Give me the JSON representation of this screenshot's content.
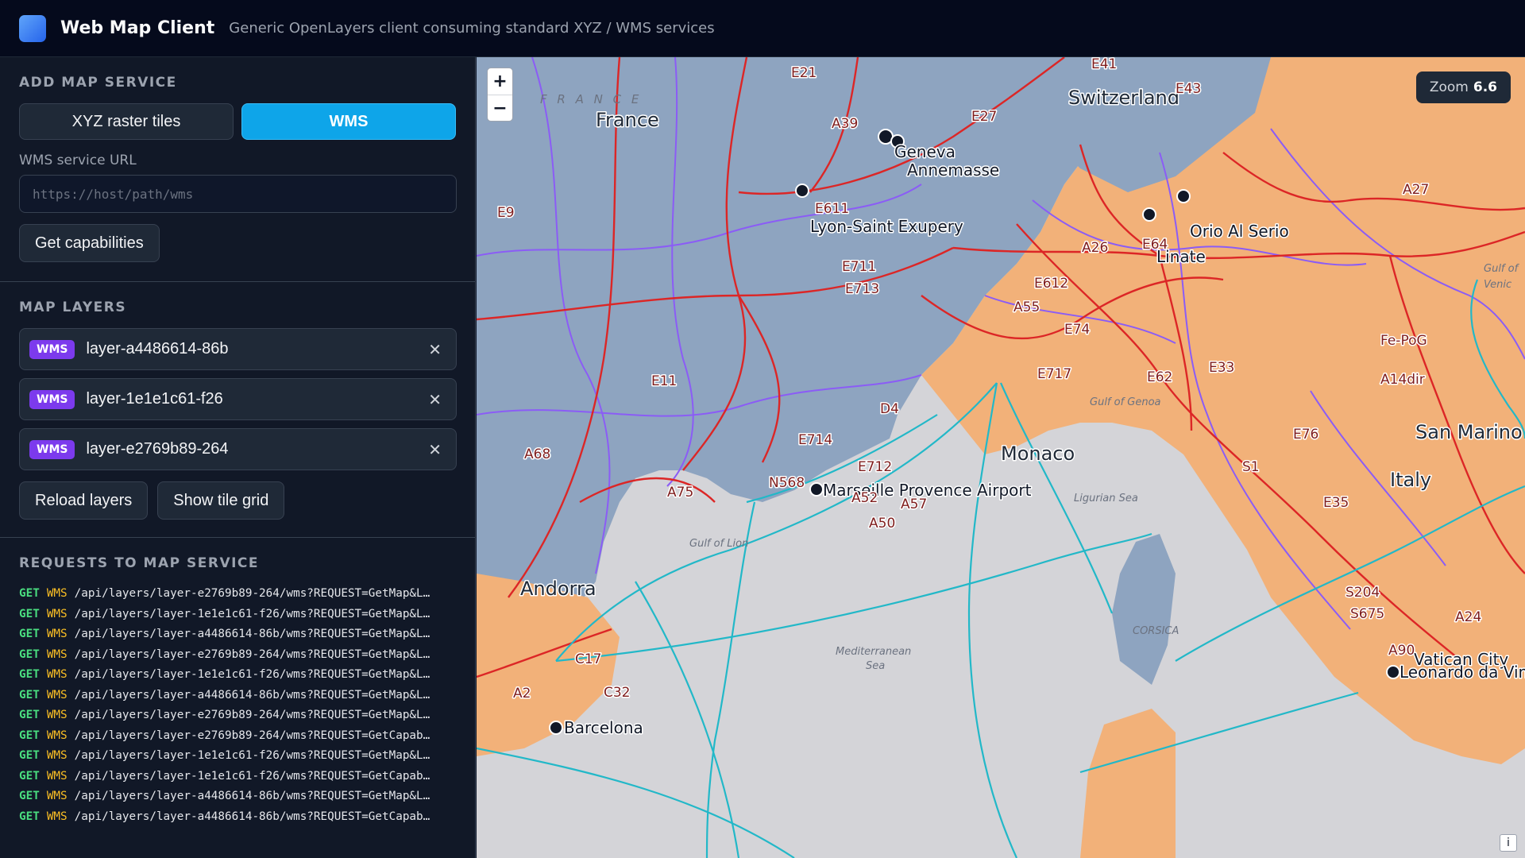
{
  "app": {
    "title": "Web Map Client",
    "subtitle": "Generic OpenLayers client consuming standard XYZ / WMS services"
  },
  "add_service": {
    "heading": "ADD MAP SERVICE",
    "tab_xyz": "XYZ raster tiles",
    "tab_wms": "WMS",
    "active_tab": "WMS",
    "url_label": "WMS service URL",
    "url_value": "",
    "url_placeholder": "https://host/path/wms",
    "capabilities_button": "Get capabilities"
  },
  "layers": {
    "heading": "MAP LAYERS",
    "items": [
      {
        "type": "WMS",
        "name": "layer-a4486614-86b",
        "remove": "✕"
      },
      {
        "type": "WMS",
        "name": "layer-1e1e1c61-f26",
        "remove": "✕"
      },
      {
        "type": "WMS",
        "name": "layer-e2769b89-264",
        "remove": "✕"
      }
    ],
    "reload_button": "Reload layers",
    "tilegrid_button": "Show tile grid"
  },
  "requests": {
    "heading": "REQUESTS TO MAP SERVICE",
    "rows": [
      {
        "method": "GET",
        "service": "WMS",
        "path": "/api/layers/layer-e2769b89-264/wms?REQUEST=GetMap&L…"
      },
      {
        "method": "GET",
        "service": "WMS",
        "path": "/api/layers/layer-1e1e1c61-f26/wms?REQUEST=GetMap&L…"
      },
      {
        "method": "GET",
        "service": "WMS",
        "path": "/api/layers/layer-a4486614-86b/wms?REQUEST=GetMap&L…"
      },
      {
        "method": "GET",
        "service": "WMS",
        "path": "/api/layers/layer-e2769b89-264/wms?REQUEST=GetMap&L…"
      },
      {
        "method": "GET",
        "service": "WMS",
        "path": "/api/layers/layer-1e1e1c61-f26/wms?REQUEST=GetMap&L…"
      },
      {
        "method": "GET",
        "service": "WMS",
        "path": "/api/layers/layer-a4486614-86b/wms?REQUEST=GetMap&L…"
      },
      {
        "method": "GET",
        "service": "WMS",
        "path": "/api/layers/layer-e2769b89-264/wms?REQUEST=GetMap&L…"
      },
      {
        "method": "GET",
        "service": "WMS",
        "path": "/api/layers/layer-e2769b89-264/wms?REQUEST=GetCapab…"
      },
      {
        "method": "GET",
        "service": "WMS",
        "path": "/api/layers/layer-1e1e1c61-f26/wms?REQUEST=GetMap&L…"
      },
      {
        "method": "GET",
        "service": "WMS",
        "path": "/api/layers/layer-1e1e1c61-f26/wms?REQUEST=GetCapab…"
      },
      {
        "method": "GET",
        "service": "WMS",
        "path": "/api/layers/layer-a4486614-86b/wms?REQUEST=GetMap&L…"
      },
      {
        "method": "GET",
        "service": "WMS",
        "path": "/api/layers/layer-a4486614-86b/wms?REQUEST=GetCapab…"
      }
    ]
  },
  "map": {
    "zoom_in": "+",
    "zoom_out": "−",
    "zoom_label": "Zoom",
    "zoom_value": "6.6",
    "attribution": "i",
    "countries": {
      "france": "France",
      "france_spaced": "F R A N C E",
      "switzerland": "Switzerland",
      "andorra": "Andorra",
      "monaco": "Monaco",
      "italy": "Italy",
      "san_marino": "San Marino",
      "vatican": "Vatican City"
    },
    "cities": {
      "geneva": "Geneva",
      "annemasse": "Annemasse",
      "lyon": "Lyon-Saint Exupery",
      "orio": "Orio Al Serio",
      "linate": "Linate",
      "marseille": "Marseille Provence Airport",
      "barcelona": "Barcelona",
      "leonardo": "Leonardo da Vinci",
      "fepog": "Fe-PoG",
      "a14dir": "A14dir"
    },
    "seas": {
      "genoa": "Gulf of Genoa",
      "ligurian": "Ligurian Sea",
      "lion": "Gulf of Lion",
      "med1": "Mediterranean",
      "med2": "Sea",
      "corsica": "CORSICA",
      "venice1": "Gulf of",
      "venice2": "Venic"
    },
    "roads": {
      "e21": "E21",
      "e41": "E41",
      "e43": "E43",
      "a39": "A39",
      "e27": "E27",
      "e9": "E9",
      "e611": "E611",
      "e711": "E711",
      "e713": "E713",
      "a26": "A26",
      "e64": "E64",
      "e612": "E612",
      "a55": "A55",
      "e74": "E74",
      "e717": "E717",
      "e62": "E62",
      "e33": "E33",
      "e11": "E11",
      "d4": "D4",
      "e714": "E714",
      "e712": "E712",
      "a68": "A68",
      "a75": "A75",
      "n568": "N568",
      "a52": "A52",
      "a57": "A57",
      "a50": "A50",
      "e76": "E76",
      "s1": "S1",
      "e35": "E35",
      "s204": "S204",
      "s675": "S675",
      "a24": "A24",
      "a90": "A90",
      "a27": "A27",
      "c17": "C17",
      "c32": "C32",
      "a2": "A2"
    }
  },
  "colors": {
    "france_fill": "#8ea4c0",
    "italy_fill": "#f2b179",
    "sea": "#d4d4d8",
    "road": "#dc2626",
    "boundary": "#8b5cf6",
    "ferry": "#22b8c8",
    "wms_badge": "#7c3aed",
    "active_tab": "#0ea5e9"
  }
}
